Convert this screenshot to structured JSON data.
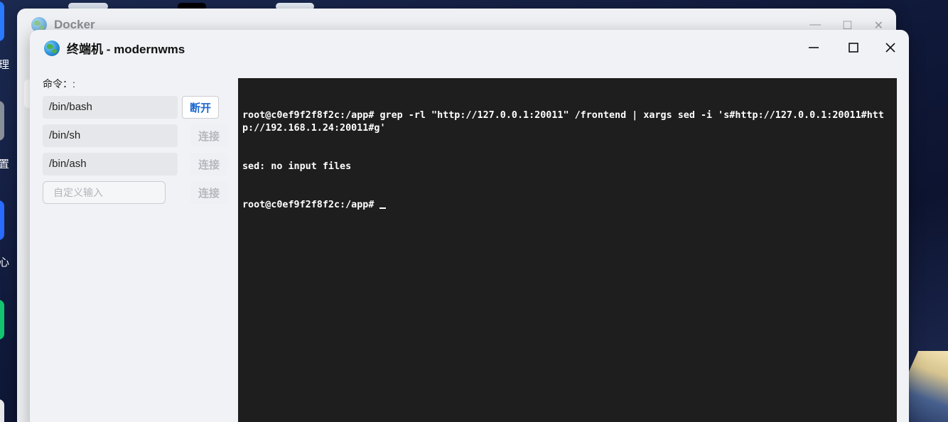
{
  "desktop": {
    "labels": [
      "理",
      "置",
      "心"
    ]
  },
  "background_window": {
    "title": "Docker"
  },
  "window": {
    "title": "终端机 - modernwms",
    "controls": {
      "minimize": "—",
      "maximize": "☐",
      "close": "✕"
    }
  },
  "commands": {
    "label": "命令：:",
    "items": [
      {
        "name": "/bin/bash",
        "action": "断开",
        "state": "connected"
      },
      {
        "name": "/bin/sh",
        "action": "连接",
        "state": "idle"
      },
      {
        "name": "/bin/ash",
        "action": "连接",
        "state": "idle"
      }
    ],
    "custom": {
      "placeholder": "自定义输入",
      "value": "",
      "action": "连接"
    }
  },
  "terminal": {
    "lines": [
      "root@c0ef9f2f8f2c:/app# grep -rl \"http://127.0.0.1:20011\" /frontend | xargs sed -i 's#http://127.0.0.1:20011#http://192.168.1.24:20011#g'",
      "sed: no input files",
      "root@c0ef9f2f8f2c:/app# "
    ]
  },
  "colors": {
    "accent": "#1a66d1",
    "terminal_bg": "#1e1e1e",
    "terminal_fg": "#ffffff"
  }
}
